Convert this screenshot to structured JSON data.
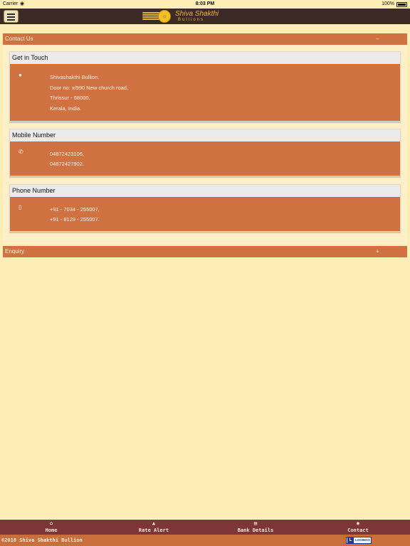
{
  "status_bar": {
    "carrier": "Carrier",
    "time": "8:03 PM",
    "battery": "100%"
  },
  "header": {
    "brand_name": "Shiva Shakthi",
    "brand_sub": "Bullions"
  },
  "contact_section": {
    "title": "Contact Us",
    "toggle": "–",
    "cards": [
      {
        "title": "Get in Touch",
        "icon": "map-pin-icon",
        "lines": [
          "Shivashakthi Bullion.",
          "Door no: x/990 New church road,",
          "Thrissur - 68000,",
          "Kerala, India."
        ]
      },
      {
        "title": "Mobile Number",
        "icon": "phone-icon",
        "lines": [
          "04872423106,",
          "04872427902."
        ]
      },
      {
        "title": "Phone Number",
        "icon": "mobile-icon",
        "lines": [
          "+91 - 7034 - 255007,",
          "+91 - 8129 - 255007."
        ]
      }
    ]
  },
  "enquiry_section": {
    "title": "Enquiry",
    "toggle": "+"
  },
  "bottom_nav": {
    "items": [
      {
        "label": "Home",
        "icon": "home-icon"
      },
      {
        "label": "Rate Alert",
        "icon": "bell-icon"
      },
      {
        "label": "Bank Details",
        "icon": "card-icon"
      },
      {
        "label": "Contact",
        "icon": "contact-icon"
      }
    ]
  },
  "footer": {
    "copyright": "©2018 Shiva Shakthi Bullion",
    "brand_mark": "LOGIMAX"
  },
  "colors": {
    "background": "#fdeeb6",
    "header": "#3b2a26",
    "accent": "#cf7141",
    "nav": "#7d3535"
  }
}
